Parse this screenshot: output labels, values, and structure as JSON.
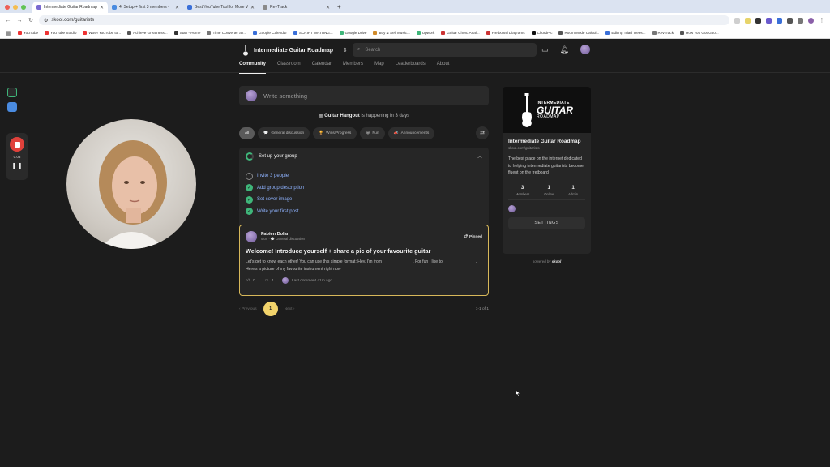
{
  "browser": {
    "tabs": [
      {
        "label": "Intermediate Guitar Roadmap",
        "active": true
      },
      {
        "label": "4. Setup + first 3 members -",
        "active": false
      },
      {
        "label": "Best YouTube Tool for More V...",
        "active": false
      },
      {
        "label": "RevTrack",
        "active": false
      }
    ],
    "new_tab": "+",
    "url": "skool.com/guitarists",
    "bookmarks": [
      "YouTube",
      "YouTube Studio",
      "Wow! YouTube to...",
      "Achieve Greatness...",
      "Stan - Home",
      "Time Converter an...",
      "Google Calendar",
      "SCRIPT WRITING...",
      "Google Drive",
      "Buy & Sell Music...",
      "Upwork",
      "Guitar Chord Anal...",
      "Fretboard Diagrams",
      "ChordPic",
      "Room Mode Calcul...",
      "Editing Triad Trees...",
      "RevTrack",
      "How You Got Goo..."
    ]
  },
  "recorder": {
    "time": "0:03"
  },
  "header": {
    "group_name": "Intermediate Guitar Roadmap",
    "search_placeholder": "Search",
    "tabs": [
      "Community",
      "Classroom",
      "Calendar",
      "Members",
      "Map",
      "Leaderboards",
      "About"
    ]
  },
  "compose": {
    "placeholder": "Write something"
  },
  "event": {
    "name": "Guitar Hangout",
    "suffix": "is happening in 3 days"
  },
  "filters": [
    "All",
    "General discussion",
    "Wins/Progress",
    "Fun",
    "Announcements"
  ],
  "filter_icons": [
    "",
    "💬",
    "🏆",
    "😀",
    "📣"
  ],
  "setup": {
    "title": "Set up your group",
    "tasks": [
      {
        "label": "Invite 3 people",
        "done": false
      },
      {
        "label": "Add group description",
        "done": true
      },
      {
        "label": "Set cover image",
        "done": true
      },
      {
        "label": "Write your first post",
        "done": true
      }
    ]
  },
  "post": {
    "author": "Fabien Dolan",
    "time": "Mon",
    "category": "General discussion",
    "pinned": "Pinned",
    "title": "Welcome! Introduce yourself + share a pic of your favourite guitar",
    "body": "Let's get to know each other! You can use this simple format: Hey, I'm from _____________. For fun I like to ______________. Here's a picture of my favourite instrument right now",
    "likes": "0",
    "comments": "1",
    "last_comment": "Last comment 41m ago"
  },
  "pager": {
    "previous": "Previous",
    "page": "1",
    "next": "Next",
    "count": "1-1 of 1"
  },
  "group_card": {
    "cover_line1": "INTERMEDIATE",
    "cover_line2": "GUITAR",
    "cover_line3": "ROADMAP",
    "name": "Intermediate Guitar Roadmap",
    "url": "skool.com/guitarists",
    "description": "The best place on the internet dedicated to helping intermediate guitarists become fluent on the fretboard",
    "stats": [
      {
        "value": "3",
        "label": "Members"
      },
      {
        "value": "1",
        "label": "Online"
      },
      {
        "value": "1",
        "label": "Admin"
      }
    ],
    "settings": "SETTINGS"
  },
  "powered_by": {
    "prefix": "powered by",
    "brand": "skool"
  },
  "colors": {
    "accent_gold": "#d7b85a",
    "success_green": "#3fb67a",
    "link_blue": "#8fb3ff",
    "record_red": "#e0413b"
  }
}
